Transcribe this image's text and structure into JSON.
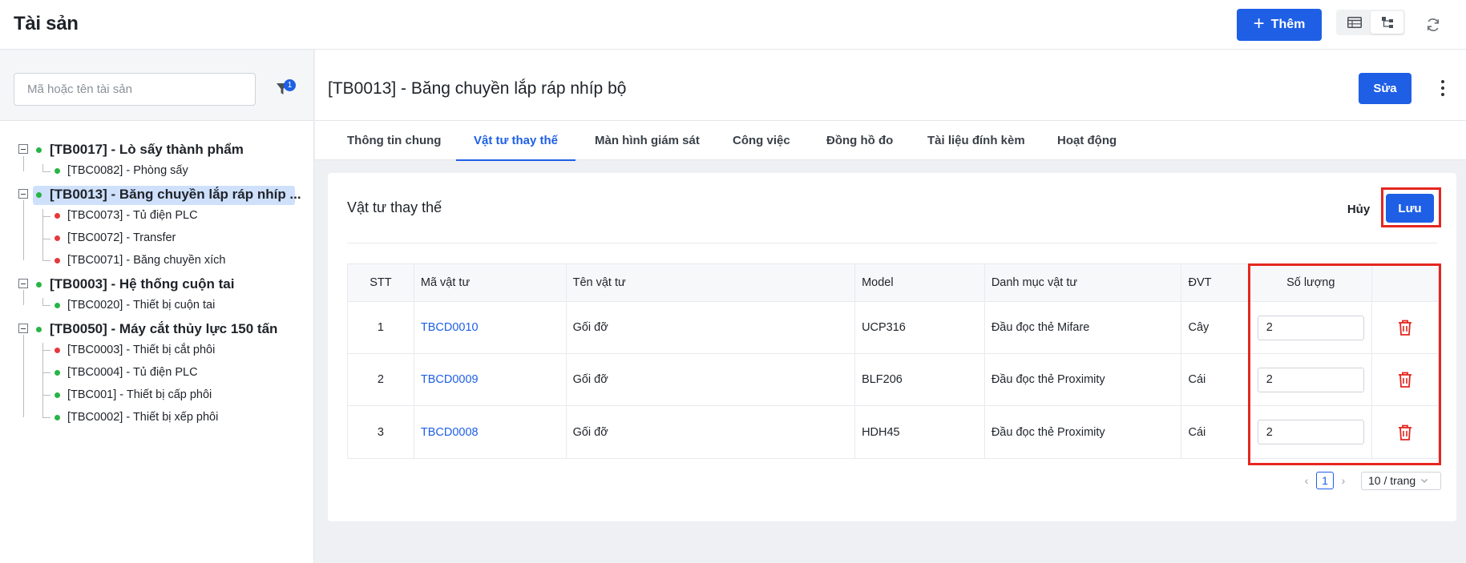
{
  "header": {
    "app_title": "Tài sản",
    "add_label": "Thêm"
  },
  "search": {
    "placeholder": "Mã hoặc tên tài sản",
    "filter_count": "1"
  },
  "tree": {
    "roots": [
      {
        "label": "[TB0017] - Lò sấy thành phẩm",
        "status": "green",
        "children": [
          {
            "label": "[TBC0082] - Phòng sấy",
            "status": "green"
          }
        ]
      },
      {
        "label": "[TB0013] - Băng chuyền lắp ráp nhíp ...",
        "status": "green",
        "selected": true,
        "children": [
          {
            "label": "[TBC0073] - Tủ điện PLC",
            "status": "red"
          },
          {
            "label": "[TBC0072] - Transfer",
            "status": "red"
          },
          {
            "label": "[TBC0071] - Băng chuyền xích",
            "status": "red"
          }
        ]
      },
      {
        "label": "[TB0003] - Hệ thống cuộn tai",
        "status": "green",
        "children": [
          {
            "label": "[TBC0020] - Thiết bị cuộn tai",
            "status": "green"
          }
        ]
      },
      {
        "label": "[TB0050] - Máy cắt thủy lực 150 tấn",
        "status": "green",
        "children": [
          {
            "label": "[TBC0003] - Thiết bị cắt phôi",
            "status": "red"
          },
          {
            "label": "[TBC0004] - Tủ điện PLC",
            "status": "green"
          },
          {
            "label": "[TBC001] - Thiết bị cấp phôi",
            "status": "green"
          },
          {
            "label": "[TBC0002] - Thiết bị xếp phôi",
            "status": "green"
          }
        ]
      }
    ]
  },
  "detail": {
    "title": "[TB0013] - Băng chuyền lắp ráp nhíp bộ",
    "edit_label": "Sửa"
  },
  "tabs": [
    {
      "label": "Thông tin chung"
    },
    {
      "label": "Vật tư thay thế",
      "active": true
    },
    {
      "label": "Màn hình giám sát"
    },
    {
      "label": "Công việc"
    },
    {
      "label": "Đồng hồ đo"
    },
    {
      "label": "Tài liệu đính kèm"
    },
    {
      "label": "Hoạt động"
    }
  ],
  "card": {
    "title": "Vật tư thay thế",
    "cancel_label": "Hủy",
    "save_label": "Lưu"
  },
  "table": {
    "columns": [
      "STT",
      "Mã vật tư",
      "Tên vật tư",
      "Model",
      "Danh mục vật tư",
      "ĐVT",
      "Số lượng",
      ""
    ],
    "rows": [
      {
        "stt": "1",
        "code": "TBCD0010",
        "name": "Gối đỡ",
        "model": "UCP316",
        "category": "Đầu đọc thẻ Mifare",
        "unit": "Cây",
        "qty": "2"
      },
      {
        "stt": "2",
        "code": "TBCD0009",
        "name": "Gối đỡ",
        "model": "BLF206",
        "category": "Đầu đọc thẻ Proximity",
        "unit": "Cái",
        "qty": "2"
      },
      {
        "stt": "3",
        "code": "TBCD0008",
        "name": "Gối đỡ",
        "model": "HDH45",
        "category": "Đầu đọc thẻ Proximity",
        "unit": "Cái",
        "qty": "2"
      }
    ]
  },
  "pagination": {
    "current_page": "1",
    "page_size": "10 / trang"
  },
  "colors": {
    "accent": "#1e5fe6",
    "status_green": "#28b446",
    "status_red": "#e5383b",
    "highlight": "#e5261f",
    "selected_bg": "#cfe0fb"
  }
}
